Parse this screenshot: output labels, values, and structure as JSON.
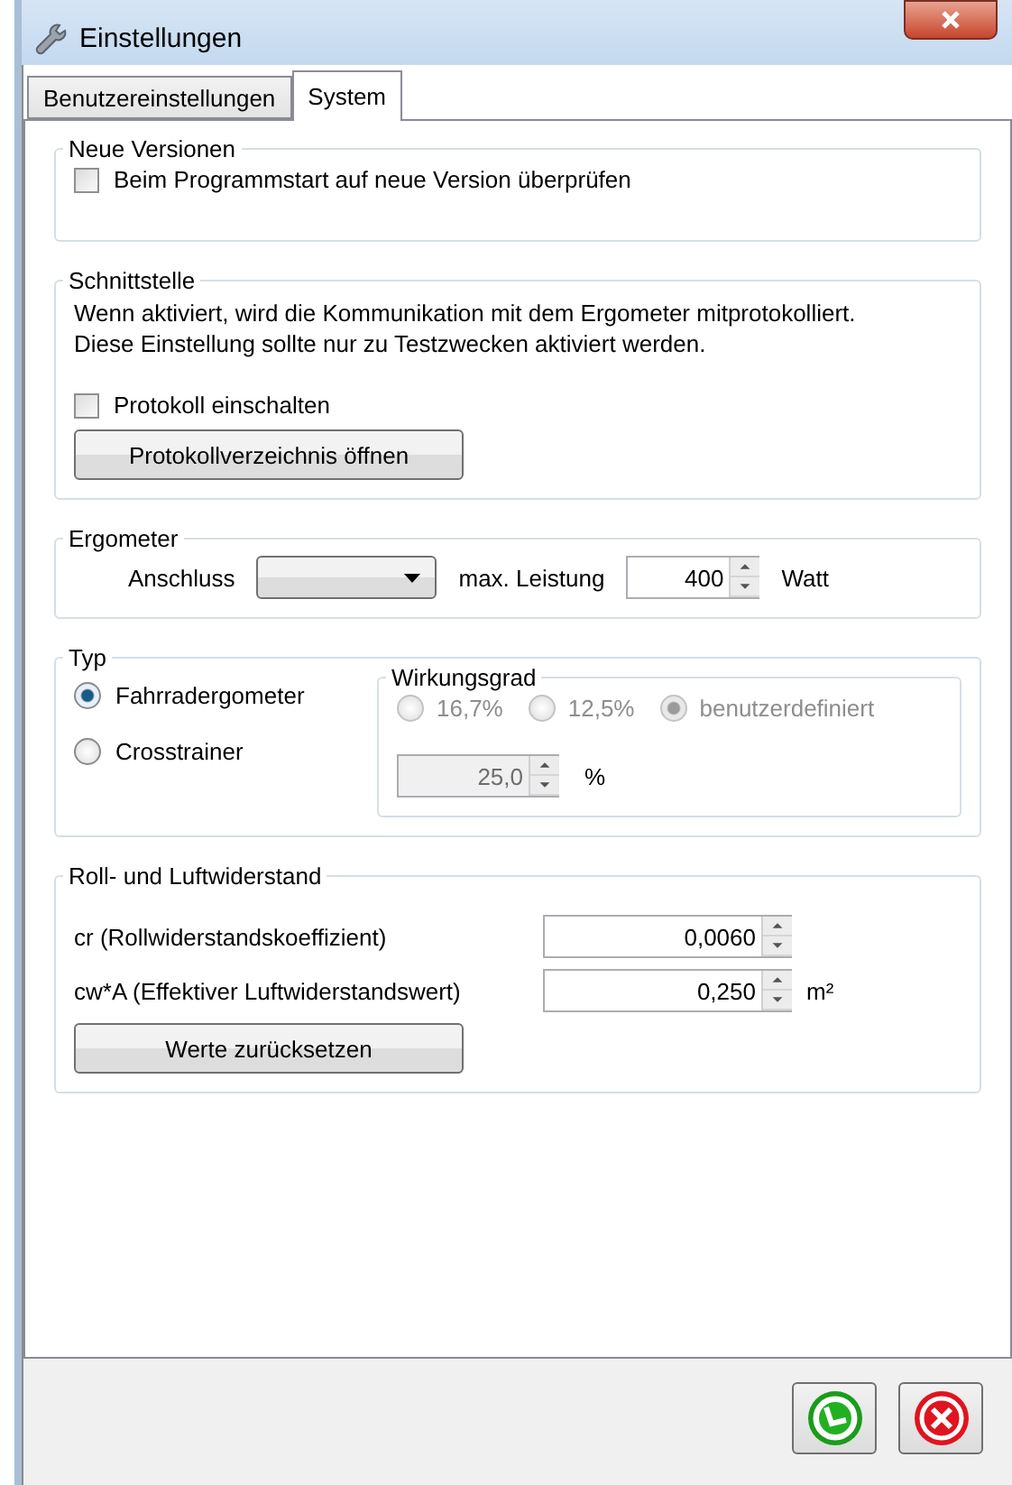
{
  "window": {
    "title": "Einstellungen"
  },
  "tabs": [
    {
      "label": "Benutzereinstellungen",
      "selected": false
    },
    {
      "label": "System",
      "selected": true
    }
  ],
  "new_versions": {
    "title": "Neue Versionen",
    "check": {
      "label": "Beim Programmstart auf neue Version überprüfen",
      "checked": false
    }
  },
  "interface": {
    "title": "Schnittstelle",
    "description": "Wenn aktiviert, wird die Kommunikation mit dem Ergometer mitprotokolliert.\nDiese Einstellung sollte nur zu Testzwecken aktiviert werden.",
    "check": {
      "label": "Protokoll einschalten",
      "checked": false
    },
    "button": "Protokollverzeichnis öffnen"
  },
  "ergometer": {
    "title": "Ergometer",
    "port_label": "Anschluss",
    "power_label": "max. Leistung",
    "power_value": "400",
    "power_unit": "Watt"
  },
  "type": {
    "title": "Typ",
    "options": [
      {
        "label": "Fahrradergometer",
        "selected": true
      },
      {
        "label": "Crosstrainer",
        "selected": false
      }
    ],
    "efficiency": {
      "title": "Wirkungsgrad",
      "disabled": true,
      "options": [
        {
          "label": "16,7%",
          "selected": false
        },
        {
          "label": "12,5%",
          "selected": false
        },
        {
          "label": "benutzerdefiniert",
          "selected": true
        }
      ],
      "value": "25,0",
      "unit": "%"
    }
  },
  "resistance": {
    "title": "Roll- und Luftwiderstand",
    "rows": [
      {
        "label": "cr (Rollwiderstandskoeffizient)",
        "value": "0,0060"
      },
      {
        "label": "cw*A (Effektiver Luftwiderstandswert)",
        "value": "0,250",
        "unit": "m²"
      }
    ],
    "button": "Werte zurücksetzen"
  }
}
